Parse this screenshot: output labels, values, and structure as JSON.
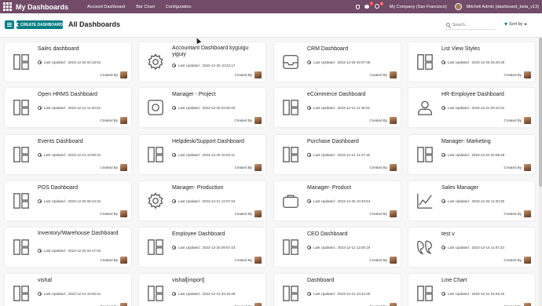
{
  "topbar": {
    "brand": "My Dashboards",
    "menus": [
      "Account Dashboard",
      "Bar Chart",
      "Configuration"
    ],
    "chat_badge": "7",
    "clock_badge": "6",
    "company": "My Company (San Francisco)",
    "user": "Mitchell Admin (dashboard_beta_v13)"
  },
  "controls": {
    "create_label": "CREATE DASHBOARD",
    "title": "All Dashboards",
    "search_placeholder": "Search...",
    "sort_label": "Sort by"
  },
  "accent_color": "#714b67",
  "button_color": "#017e84",
  "cards": [
    {
      "title": "Sales dashboard",
      "updated": "Last Updated : 2023-12-26 04:16:54",
      "created": "Created By",
      "icon": "layout-grid-icon"
    },
    {
      "title": "Accountant Dashboard kyguigu yiguiy",
      "updated": "Last Updated : 2023-12-25 10:22:17",
      "created": "Created By",
      "icon": "gear-icon"
    },
    {
      "title": "CRM Dashboard",
      "updated": "Last Updated : 2023-12-25 04:57:06",
      "created": "Created By",
      "icon": "inbox-icon"
    },
    {
      "title": "List View Styles",
      "updated": "Last Updated : 2023-12-26 04:30:29",
      "created": "Created By",
      "icon": "layout-grid-icon"
    },
    {
      "title": "Open HRMS Dashboard",
      "updated": "Last Updated : 2023-12-14 11:40:22",
      "created": "Created By",
      "icon": "layout-grid-icon"
    },
    {
      "title": "Manager - Project",
      "updated": "Last Updated : 2023-12-20 04:50:20",
      "created": "Created By",
      "icon": "camera-icon"
    },
    {
      "title": "eCommerce Dashboard",
      "updated": "Last Updated : 2023-12-14 11:46:01",
      "created": "Created By",
      "icon": "layout-grid-icon"
    },
    {
      "title": "HR-Employee Dashboard",
      "updated": "Last Updated : 2023-12-21 09:34:42",
      "created": "Created By",
      "icon": "user-icon"
    },
    {
      "title": "Events Dashboard",
      "updated": "Last Updated : 2023-12-21 10:50:31",
      "created": "Created By",
      "icon": "layout-grid-icon"
    },
    {
      "title": "Helpdesk/Support Dashboard",
      "updated": "Last Updated : 2023-12-20 10:02:11",
      "created": "Created By",
      "icon": "layout-grid-icon"
    },
    {
      "title": "Purchase Dashboard",
      "updated": "Last Updated : 2023-12-14 11:47:16",
      "created": "Created By",
      "icon": "layout-grid-icon"
    },
    {
      "title": "Manager- Marketing",
      "updated": "Last Updated : 2023-12-22 04:58:28",
      "created": "Created By",
      "icon": "layout-grid-icon"
    },
    {
      "title": "POS Dashboard",
      "updated": "Last Updated : 2023-12-25 06:24:34",
      "created": "Created By",
      "icon": "layout-grid-icon"
    },
    {
      "title": "Manager- Production",
      "updated": "Last Updated : 2023-12-21 12:07:23",
      "created": "Created By",
      "icon": "gear-icon"
    },
    {
      "title": "Manager- Product",
      "updated": "Last Updated : 2023-12-25 10:40:54",
      "created": "Created By",
      "icon": "briefcase-icon"
    },
    {
      "title": "Sales Manager",
      "updated": "Last Updated : 2023-12-26 11:20:28",
      "created": "Created By",
      "icon": "line-chart-icon"
    },
    {
      "title": "Inventory/Warehouse Dashboard",
      "updated": "Last Updated : 2023-12-26 04:17:04",
      "created": "Created By",
      "icon": "layout-grid-icon"
    },
    {
      "title": "Employee Dashboard",
      "updated": "Last Updated : 2023-12-25 09:57:43",
      "created": "Created By",
      "icon": "layout-grid-icon"
    },
    {
      "title": "CEO Dashboard",
      "updated": "Last Updated : 2023-12-12 12:55:19",
      "created": "Created By",
      "icon": "layout-grid-icon"
    },
    {
      "title": "test v",
      "updated": "Last Updated : 2023-12-14 11:57:23",
      "created": "Created By",
      "icon": "quote-icon"
    },
    {
      "title": "vishal",
      "updated": "Last Updated : 2023-12-14 10:50:01",
      "created": "Created By",
      "icon": "layout-grid-icon"
    },
    {
      "title": "vishal[import]",
      "updated": "Last Updated : 2023-12-21 04:16:49",
      "created": "Created By",
      "icon": "layout-grid-icon"
    },
    {
      "title": "Dashboard",
      "updated": "Last Updated : 2023-12-21 10:24:30",
      "created": "Created By",
      "icon": "layout-grid-icon"
    },
    {
      "title": "Line Chart",
      "updated": "Last Updated : 2023-12-21 04:45:42",
      "created": "Created By",
      "icon": "layout-grid-icon"
    }
  ]
}
